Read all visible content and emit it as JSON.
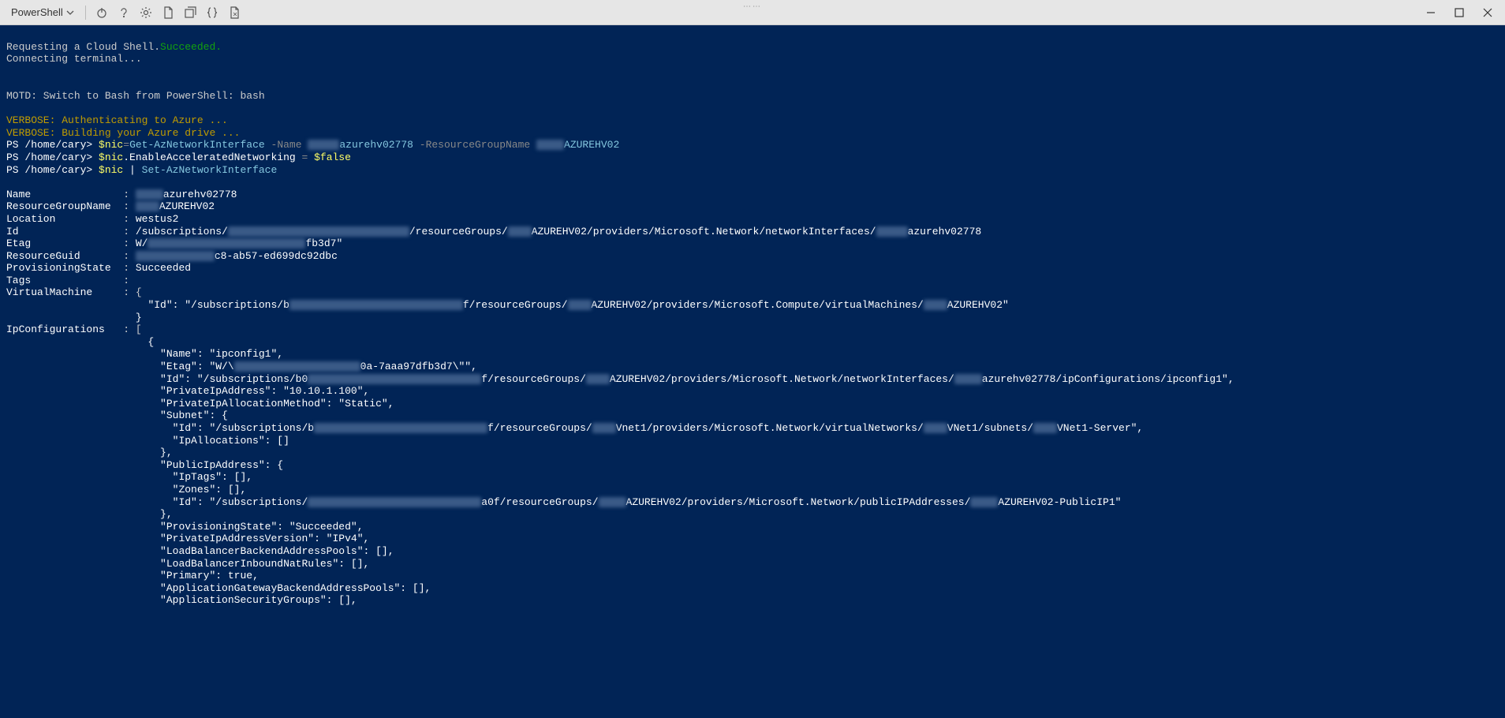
{
  "toolbar": {
    "shell": "PowerShell"
  },
  "terminal": {
    "line_request": "Requesting a Cloud Shell.",
    "succeeded": "Succeeded.",
    "connecting": "Connecting terminal...",
    "motd": "MOTD: Switch to Bash from PowerShell: bash",
    "verbose1": "VERBOSE: Authenticating to Azure ...",
    "verbose2": "VERBOSE: Building your Azure drive ...",
    "prompt": "PS /home/cary>",
    "cmd1": {
      "part1": "$nic",
      "eq": "=",
      "part2": "Get-AzNetworkInterface",
      "flag1": "-Name",
      "val1_suffix": "azurehv02778",
      "flag2": "-ResourceGroupName",
      "val2_suffix": "AZUREHV02"
    },
    "cmd2": {
      "part1": "$nic",
      "dot": ".EnableAcceleratedNetworking",
      "eq": " = ",
      "val": "$false"
    },
    "cmd3": {
      "part1": "$nic",
      "pipe": " | ",
      "part2": "Set-AzNetworkInterface"
    },
    "output": {
      "Name_label": "Name",
      "Name_val_suffix": "azurehv02778",
      "RG_label": "ResourceGroupName",
      "RG_val_suffix": "AZUREHV02",
      "Location_label": "Location",
      "Location_val": "westus2",
      "Id_label": "Id",
      "Id_pre": "/subscriptions/",
      "Id_mid": "/resourceGroups/",
      "Id_mid2": "AZUREHV02/providers/Microsoft.Network/networkInterfaces/",
      "Id_end": "azurehv02778",
      "Etag_label": "Etag",
      "Etag_pre": "W/",
      "Etag_end": "fb3d7\"",
      "ResourceGuid_label": "ResourceGuid",
      "ResourceGuid_end": "c8-ab57-ed699dc92dbc",
      "ProvisioningState_label": "ProvisioningState",
      "ProvisioningState_val": "Succeeded",
      "Tags_label": "Tags",
      "VM_label": "VirtualMachine",
      "VM_id_pre": "\"Id\": \"/subscriptions/b",
      "VM_id_mid": "f/resourceGroups/",
      "VM_id_end": "AZUREHV02/providers/Microsoft.Compute/virtualMachines/",
      "VM_id_tail": "AZUREHV02\"",
      "IpCfg_label": "IpConfigurations",
      "ipc_name": "\"Name\": \"ipconfig1\",",
      "ipc_etag_pre": "\"Etag\": \"W/\\",
      "ipc_etag_end": "0a-7aaa97dfb3d7\\\"\",",
      "ipc_id_pre": "\"Id\": \"/subscriptions/b0",
      "ipc_id_mid": "f/resourceGroups/",
      "ipc_id_end": "AZUREHV02/providers/Microsoft.Network/networkInterfaces/",
      "ipc_id_tail": "azurehv02778/ipConfigurations/ipconfig1\",",
      "ipc_privip": "\"PrivateIpAddress\": \"10.10.1.100\",",
      "ipc_method": "\"PrivateIpAllocationMethod\": \"Static\",",
      "ipc_subnet": "\"Subnet\": {",
      "ipc_subnet_id_pre": "\"Id\": \"/subscriptions/b",
      "ipc_subnet_id_mid": "f/resourceGroups/",
      "ipc_subnet_id_end1": "Vnet1/providers/Microsoft.Network/virtualNetworks/",
      "ipc_subnet_id_end2": "VNet1/subnets/",
      "ipc_subnet_id_end3": "VNet1-Server\",",
      "ipc_ipalloc": "\"IpAllocations\": []",
      "ipc_close1": "},",
      "ipc_publicip": "\"PublicIpAddress\": {",
      "ipc_iptags": "\"IpTags\": [],",
      "ipc_zones": "\"Zones\": [],",
      "ipc_pub_id_pre": "\"Id\": \"/subscriptions/",
      "ipc_pub_id_mid": "a0f/resourceGroups/",
      "ipc_pub_id_end": "AZUREHV02/providers/Microsoft.Network/publicIPAddresses/",
      "ipc_pub_id_tail": "AZUREHV02-PublicIP1\"",
      "ipc_close2": "},",
      "ipc_provstate": "\"ProvisioningState\": \"Succeeded\",",
      "ipc_privver": "\"PrivateIpAddressVersion\": \"IPv4\",",
      "ipc_lb_pools": "\"LoadBalancerBackendAddressPools\": [],",
      "ipc_lb_nat": "\"LoadBalancerInboundNatRules\": [],",
      "ipc_primary": "\"Primary\": true,",
      "ipc_agw": "\"ApplicationGatewayBackendAddressPools\": [],",
      "ipc_asg": "\"ApplicationSecurityGroups\": [],"
    }
  }
}
